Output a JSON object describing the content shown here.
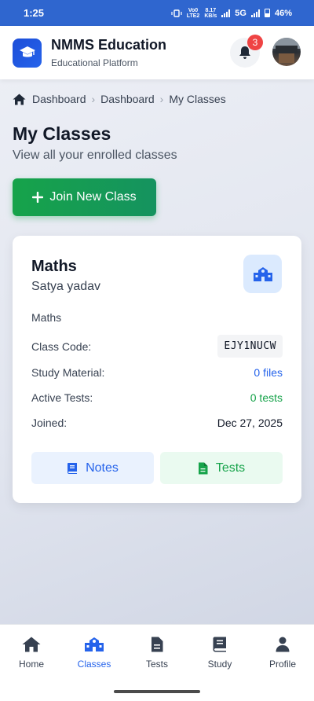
{
  "status_bar": {
    "time": "1:25",
    "volte_top": "Vo0",
    "volte_bottom": "LTE2",
    "speed_top": "8.17",
    "speed_bottom": "KB/s",
    "network": "5G",
    "battery": "46%"
  },
  "header": {
    "app_title": "NMMS Education",
    "app_subtitle": "Educational Platform",
    "notification_count": "3"
  },
  "breadcrumb": {
    "items": [
      "Dashboard",
      "Dashboard",
      "My Classes"
    ]
  },
  "page": {
    "title": "My Classes",
    "subtitle": "View all your enrolled classes",
    "join_button": "Join New Class"
  },
  "class_card": {
    "name": "Maths",
    "teacher": "Satya yadav",
    "subject": "Maths",
    "code_label": "Class Code:",
    "code_value": "EJY1NUCW",
    "material_label": "Study Material:",
    "material_value": "0 files",
    "tests_label": "Active Tests:",
    "tests_value": "0 tests",
    "joined_label": "Joined:",
    "joined_value": "Dec 27, 2025",
    "notes_button": "Notes",
    "tests_button": "Tests"
  },
  "bottom_nav": {
    "items": [
      {
        "label": "Home",
        "icon": "home-icon"
      },
      {
        "label": "Classes",
        "icon": "school-icon"
      },
      {
        "label": "Tests",
        "icon": "document-icon"
      },
      {
        "label": "Study",
        "icon": "book-icon"
      },
      {
        "label": "Profile",
        "icon": "user-icon"
      }
    ],
    "active": "Classes"
  },
  "colors": {
    "status_bar": "#2f66cf",
    "primary": "#2563eb",
    "success": "#16a34a",
    "badge": "#ef4444"
  }
}
